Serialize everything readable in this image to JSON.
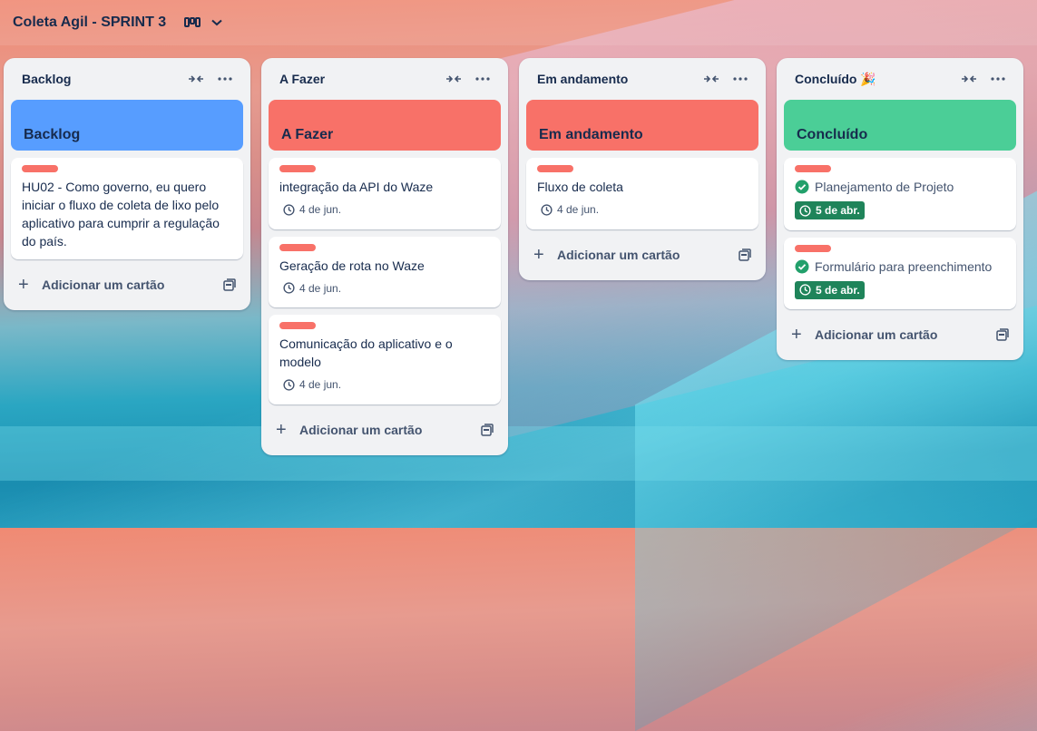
{
  "board": {
    "title": "Coleta Agil - SPRINT 3"
  },
  "add_card_label": "Adicionar um cartão",
  "lists": [
    {
      "title": "Backlog",
      "cover": {
        "title": "Backlog",
        "color": "#579dff"
      },
      "cards": [
        {
          "title": "HU02 - Como governo, eu quero iniciar o fluxo de coleta de lixo pelo aplicativo para cumprir a regulação do país."
        }
      ]
    },
    {
      "title": "A Fazer",
      "cover": {
        "title": "A Fazer",
        "color": "#f87168"
      },
      "cards": [
        {
          "title": "integração da API do Waze",
          "due": "4 de jun."
        },
        {
          "title": "Geração de rota no Waze",
          "due": "4 de jun."
        },
        {
          "title": "Comunicação do aplicativo e o modelo",
          "due": "4 de jun."
        }
      ]
    },
    {
      "title": "Em andamento",
      "cover": {
        "title": "Em andamento",
        "color": "#f87168"
      },
      "cards": [
        {
          "title": "Fluxo de coleta",
          "due": "4 de jun."
        }
      ]
    },
    {
      "title": "Concluído 🎉",
      "cover": {
        "title": "Concluído",
        "color": "#4bce97"
      },
      "cards": [
        {
          "title": "Planejamento de Projeto",
          "due": "5 de abr.",
          "complete": true
        },
        {
          "title": "Formulário para preenchimento",
          "due": "5 de abr.",
          "complete": true
        }
      ]
    }
  ],
  "colors": {
    "label_red": "#f87168",
    "due_complete": "#1f845a"
  }
}
